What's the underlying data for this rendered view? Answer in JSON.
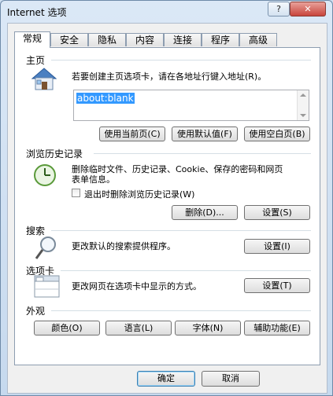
{
  "window": {
    "title": "Internet 选项",
    "help_label": "?",
    "close_label": "✕"
  },
  "tabs": [
    "常规",
    "安全",
    "隐私",
    "内容",
    "连接",
    "程序",
    "高级"
  ],
  "home": {
    "section_title": "主页",
    "description": "若要创建主页选项卡，请在各地址行键入地址(R)。",
    "url_value": "about:blank",
    "use_current": "使用当前页(C)",
    "use_default": "使用默认值(F)",
    "use_blank": "使用空白页(B)",
    "icon": "house-icon"
  },
  "history": {
    "section_title": "浏览历史记录",
    "description_line1": "删除临时文件、历史记录、Cookie、保存的密码和网页",
    "description_line2": "表单信息。",
    "checkbox_label": "退出时删除浏览历史记录(W)",
    "checkbox_checked": false,
    "delete_button": "删除(D)...",
    "settings_button": "设置(S)",
    "icon": "clock-icon"
  },
  "search": {
    "section_title": "搜索",
    "description": "更改默认的搜索提供程序。",
    "settings_button": "设置(I)",
    "icon": "magnifier-icon"
  },
  "tabs_section": {
    "section_title": "选项卡",
    "description": "更改网页在选项卡中显示的方式。",
    "settings_button": "设置(T)",
    "icon": "tabs-window-icon"
  },
  "appearance": {
    "section_title": "外观",
    "colors_button": "颜色(O)",
    "languages_button": "语言(L)",
    "fonts_button": "字体(N)",
    "accessibility_button": "辅助功能(E)"
  },
  "footer": {
    "ok_button": "确定",
    "cancel_button": "取消"
  }
}
